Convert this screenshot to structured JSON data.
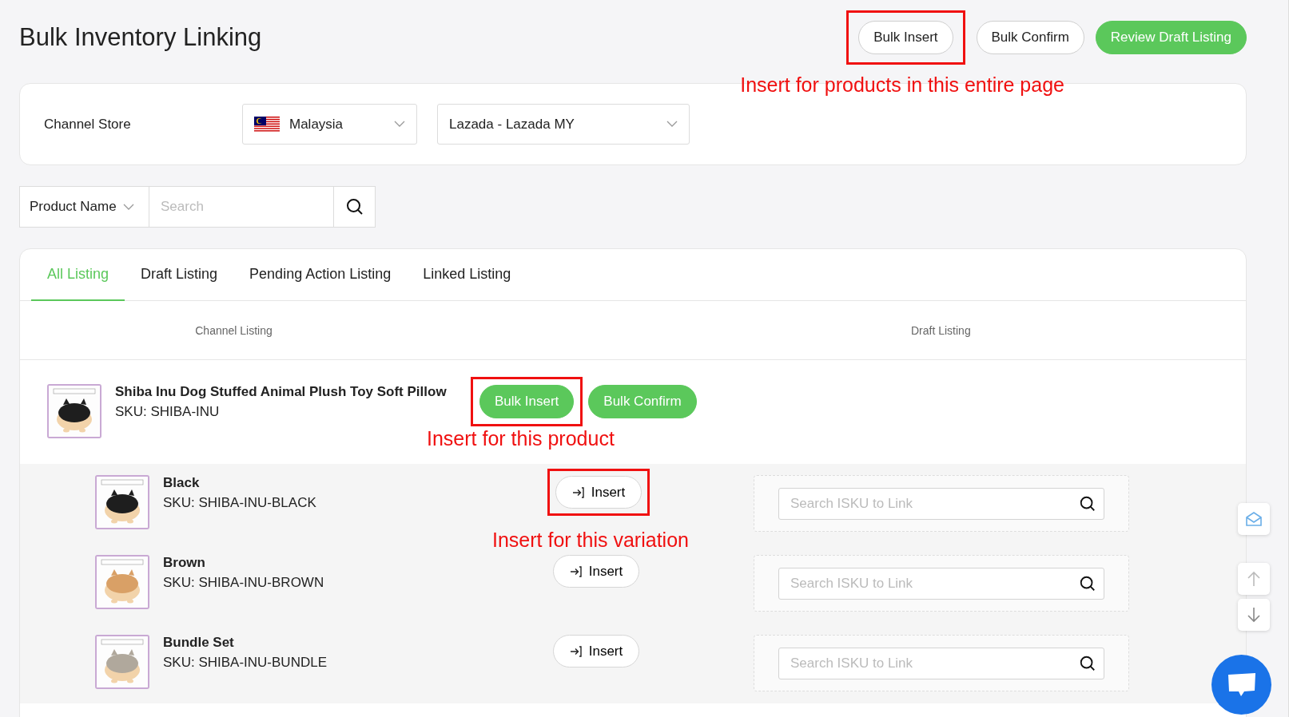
{
  "title": "Bulk Inventory Linking",
  "header_buttons": [
    {
      "label": "Bulk Insert",
      "kind": "outline",
      "highlighted": true
    },
    {
      "label": "Bulk Confirm",
      "kind": "outline",
      "highlighted": false
    },
    {
      "label": "Review Draft Listing",
      "kind": "primary",
      "highlighted": false
    }
  ],
  "header_note": "Insert for products in this entire page",
  "channel_store": {
    "label": "Channel Store",
    "country": "Malaysia",
    "store": "Lazada - Lazada MY"
  },
  "filter": {
    "field": "Product Name",
    "placeholder": "Search"
  },
  "tabs": [
    {
      "label": "All Listing",
      "selected": true
    },
    {
      "label": "Draft Listing",
      "selected": false
    },
    {
      "label": "Pending Action Listing",
      "selected": false
    },
    {
      "label": "Linked Listing",
      "selected": false
    }
  ],
  "columns": [
    "Channel Listing",
    "Draft Listing"
  ],
  "product": {
    "name": "Shiba Inu Dog Stuffed Animal Plush Toy Soft Pillow",
    "sku": "SKU: SHIBA-INU",
    "buttons": [
      {
        "label": "Bulk Insert",
        "highlighted": true
      },
      {
        "label": "Bulk Confirm",
        "highlighted": false
      }
    ],
    "note": "Insert for this product"
  },
  "variations": [
    {
      "name": "Black",
      "sku": "SKU: SHIBA-INU-BLACK",
      "button": "Insert",
      "highlighted": true,
      "note": "Insert for this variation",
      "placeholder": "Search ISKU to Link"
    },
    {
      "name": "Brown",
      "sku": "SKU: SHIBA-INU-BROWN",
      "button": "Insert",
      "highlighted": false,
      "placeholder": "Search ISKU to Link"
    },
    {
      "name": "Bundle Set",
      "sku": "SKU: SHIBA-INU-BUNDLE",
      "button": "Insert",
      "highlighted": false,
      "placeholder": "Search ISKU to Link"
    }
  ]
}
